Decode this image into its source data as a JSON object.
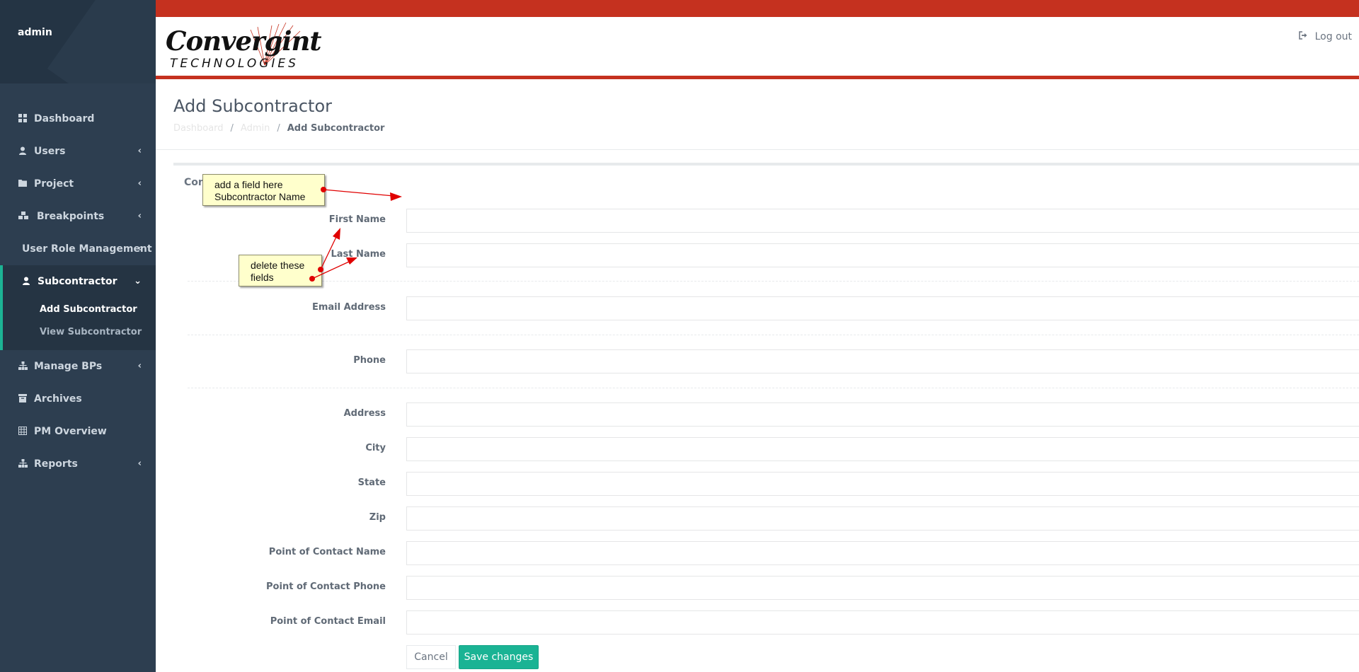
{
  "user": {
    "name": "admin"
  },
  "sidebar": {
    "items": [
      {
        "label": "Dashboard",
        "icon": "dashboard-icon",
        "chevron": false
      },
      {
        "label": "Users",
        "icon": "user-icon",
        "chevron": true
      },
      {
        "label": "Project",
        "icon": "folder-icon",
        "chevron": true
      },
      {
        "label": "Breakpoints",
        "icon": "cubes-icon",
        "chevron": true
      },
      {
        "label": "User Role Management",
        "icon": "",
        "chevron": true
      },
      {
        "label": "Subcontractor",
        "icon": "user-icon",
        "chevron": true,
        "active": true
      },
      {
        "label": "Manage BPs",
        "icon": "sitemap-icon",
        "chevron": true
      },
      {
        "label": "Archives",
        "icon": "archive-icon",
        "chevron": false
      },
      {
        "label": "PM Overview",
        "icon": "table-icon",
        "chevron": false
      },
      {
        "label": "Reports",
        "icon": "sitemap-icon",
        "chevron": true
      }
    ],
    "submenu": [
      {
        "label": "Add Subcontractor",
        "current": true
      },
      {
        "label": "View Subcontractor",
        "current": false
      }
    ]
  },
  "header": {
    "logo_word": "Convergint",
    "logo_sub": "TECHNOLOGIES",
    "logout_label": "Log out"
  },
  "page": {
    "title": "Add Subcontractor",
    "breadcrumb": [
      "Dashboard",
      "Admin",
      "Add Subcontractor"
    ],
    "breadcrumb_sep": "/"
  },
  "form": {
    "section_label": "Con",
    "fields": [
      {
        "label": "First Name",
        "value": ""
      },
      {
        "label": "Last Name",
        "value": ""
      },
      {
        "label": "Email Address",
        "value": ""
      },
      {
        "label": "Phone",
        "value": ""
      },
      {
        "label": "Address",
        "value": ""
      },
      {
        "label": "City",
        "value": ""
      },
      {
        "label": "State",
        "value": ""
      },
      {
        "label": "Zip",
        "value": ""
      },
      {
        "label": "Point of Contact Name",
        "value": ""
      },
      {
        "label": "Point of Contact Phone",
        "value": ""
      },
      {
        "label": "Point of Contact Email",
        "value": ""
      }
    ],
    "cancel_label": "Cancel",
    "save_label": "Save changes"
  },
  "annotations": [
    {
      "line1": "add a field here",
      "line2": "Subcontractor Name"
    },
    {
      "line1": "delete these",
      "line2": "fields"
    }
  ],
  "colors": {
    "sidebar_bg": "#2d3e50",
    "brand_red": "#c5311f",
    "accent_green": "#1ab394",
    "note_bg": "#ffffcc",
    "arrow_red": "#e00000"
  }
}
